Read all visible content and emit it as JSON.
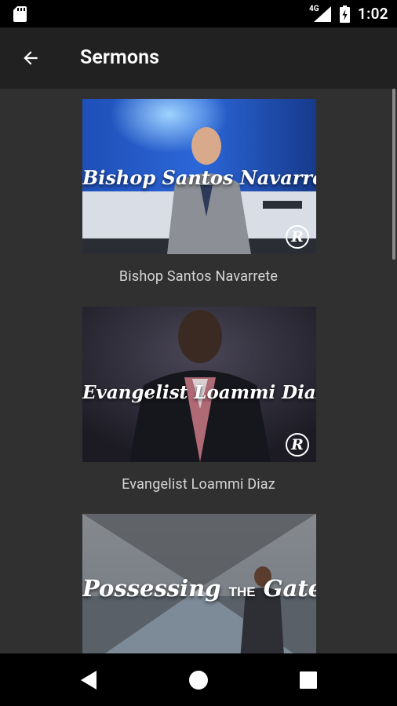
{
  "status_bar": {
    "network_label": "4G",
    "time": "1:02"
  },
  "app_bar": {
    "title": "Sermons"
  },
  "sermons": [
    {
      "thumbnail_text": "Bishop Santos Navarrete",
      "caption": "Bishop Santos Navarrete"
    },
    {
      "thumbnail_text": "Evangelist Loammi Diaz",
      "caption": "Evangelist Loammi Diaz"
    },
    {
      "thumbnail_text_part1": "Possessing",
      "thumbnail_text_part2": "THE",
      "thumbnail_text_part3": "Gates"
    }
  ],
  "logo_letter": "R",
  "colors": {
    "background": "#303030",
    "app_bar": "#212121",
    "caption_text": "#d6d6d6"
  }
}
